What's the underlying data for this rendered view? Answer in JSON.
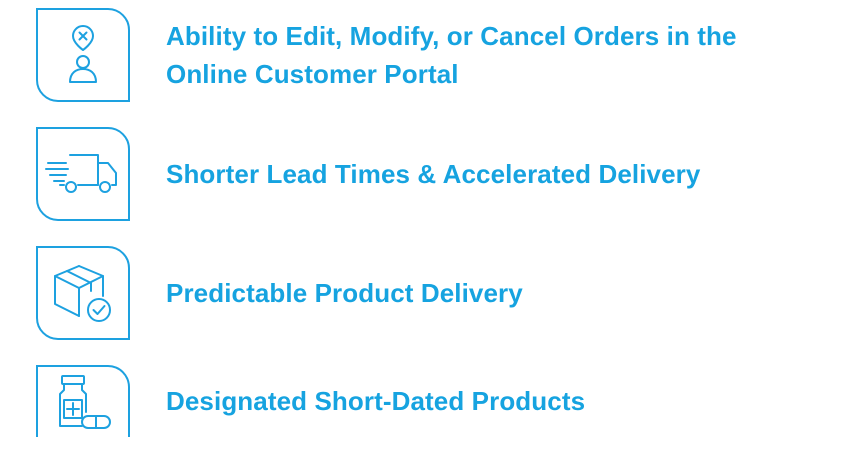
{
  "accent_color": "#16a3e0",
  "features": [
    {
      "icon": "location-person-icon",
      "lines": [
        "Ability to Edit, Modify, or Cancel Orders in the",
        "Online Customer Portal"
      ]
    },
    {
      "icon": "delivery-truck-icon",
      "lines": [
        "Shorter Lead Times & Accelerated Delivery"
      ]
    },
    {
      "icon": "box-check-icon",
      "lines": [
        "Predictable Product Delivery"
      ]
    },
    {
      "icon": "medicine-bottle-icon",
      "lines": [
        "Designated Short-Dated Products"
      ]
    }
  ]
}
